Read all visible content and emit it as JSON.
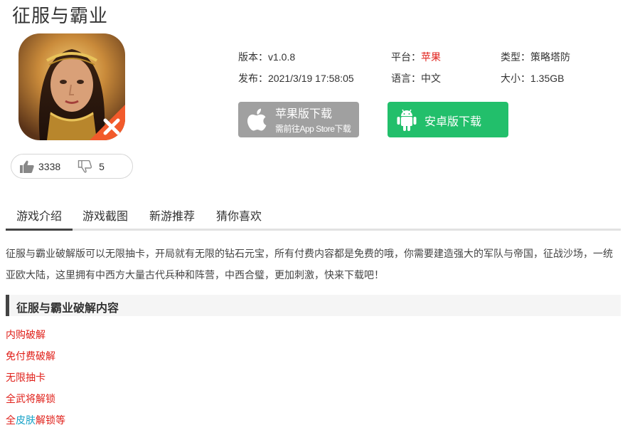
{
  "game": {
    "title": "征服与霸业"
  },
  "votes": {
    "up_count": "3338",
    "down_count": "5"
  },
  "info": {
    "version_label": "版本：",
    "version_value": "v1.0.8",
    "platform_label": "平台：",
    "platform_value": "苹果",
    "type_label": "类型：",
    "type_value": "策略塔防",
    "publish_label": "发布：",
    "publish_value": "2021/3/19 17:58:05",
    "language_label": "语言：",
    "language_value": "中文",
    "size_label": "大小：",
    "size_value": "1.35GB"
  },
  "download": {
    "ios_label": "苹果版下载",
    "ios_sublabel": "需前往App Store下载",
    "android_label": "安卓版下载"
  },
  "tabs": [
    {
      "label": "游戏介绍",
      "active": true
    },
    {
      "label": "游戏截图",
      "active": false
    },
    {
      "label": "新游推荐",
      "active": false
    },
    {
      "label": "猜你喜欢",
      "active": false
    }
  ],
  "description": "征服与霸业破解版可以无限抽卡，开局就有无限的钻石元宝，所有付费内容都是免费的哦，你需要建造强大的军队与帝国，征战沙场，一统亚欧大陆，这里拥有中西方大量古代兵种和阵营，中西合璧，更加刺激，快来下载吧！",
  "section": {
    "heading": "征服与霸业破解内容"
  },
  "features": {
    "item1": "内购破解",
    "item2": "免付费破解",
    "item3": "无限抽卡",
    "item4": "全武将解锁",
    "item5_part1": "全",
    "item5_part2": "皮肤",
    "item5_part3": "解锁等"
  },
  "colors": {
    "accent_red": "#e0201a",
    "android_green": "#22bf6b",
    "ios_gray": "#a0a0a0",
    "link_cyan": "#1aa3c8"
  },
  "icons": {
    "thumb_up": "thumbs-up-icon",
    "thumb_down": "thumbs-down-icon",
    "apple": "apple-icon",
    "android": "android-icon"
  }
}
